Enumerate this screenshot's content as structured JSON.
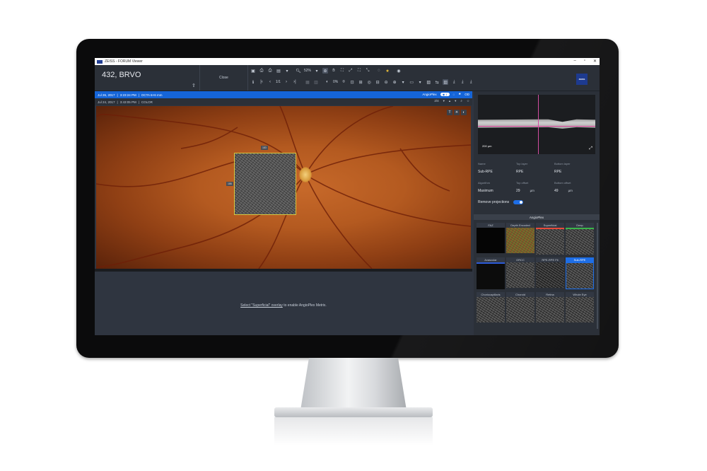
{
  "window": {
    "title": "ZEISS - FORUM Viewer",
    "controls": [
      "–",
      "▫",
      "✕"
    ]
  },
  "header": {
    "patient": "432, BRVO",
    "close_label": "Close",
    "zoom": "52%",
    "page": "1/1",
    "opacity": "0%",
    "brand": "ZEISS"
  },
  "bluebar": {
    "date": "Jul 26, 2017",
    "time": "3:23:24 PM",
    "exam": "OCTA 6×6 mm",
    "mode": "AngioPlex",
    "od": "OD"
  },
  "subbar": {
    "date": "Jul 24, 2017",
    "time": "3:43:05 PM",
    "type": "COLOR",
    "counter": "2/4"
  },
  "fundus": {
    "label_top": "183",
    "label_left": "186"
  },
  "message": {
    "link": "Select \"Superficial\" overlay",
    "rest": " to enable AngioPlex Metrix."
  },
  "bscan": {
    "scale": "200 µm"
  },
  "params": {
    "name_label": "Name",
    "name": "Sub-RPE",
    "top_layer_label": "Top layer",
    "top_layer": "RPE",
    "bottom_layer_label": "Bottom layer",
    "bottom_layer": "RPE",
    "algorithm_label": "Algorithm",
    "algorithm": "Maximum",
    "top_offset_label": "Top offset",
    "top_offset": "29",
    "bottom_offset_label": "Bottom offset",
    "bottom_offset": "49",
    "unit": "µm",
    "remove_projections": "Remove projections"
  },
  "angioplex": {
    "title": "AngioPlex",
    "tiles": [
      {
        "label": "FAZ"
      },
      {
        "label": "Depth Encoded"
      },
      {
        "label": "Superficial"
      },
      {
        "label": "Deep"
      },
      {
        "label": "Avascular"
      },
      {
        "label": "ORCC"
      },
      {
        "label": "RPE-RPE Fit"
      },
      {
        "label": "Sub-RPE"
      },
      {
        "label": "Choriocapillaris"
      },
      {
        "label": "Choroid"
      },
      {
        "label": "Retina"
      },
      {
        "label": "Whole Eye"
      }
    ]
  },
  "colors": {
    "accent": "#1565d8",
    "panel": "#2b3038",
    "background": "#2f3540",
    "scan_border": "#d8c740"
  }
}
